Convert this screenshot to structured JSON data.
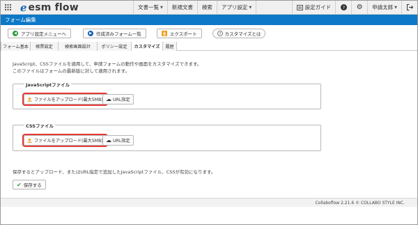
{
  "header": {
    "logo_text": "esm flow",
    "nav": [
      "文書一覧",
      "新規文書",
      "検索",
      "アプリ設定"
    ],
    "guide_label": "設定ガイド",
    "user_label": "申請太郎"
  },
  "title_bar": "フォーム編集",
  "toolbar": {
    "back_label": "アプリ設定メニューへ",
    "forms_label": "作成済みフォーム一覧",
    "export_label": "エクスポート",
    "customize_help_label": "カスタマイズとは"
  },
  "tabs": [
    "フォーム基本",
    "帳票設定",
    "検索画面設計",
    "ポリシー設定",
    "カスタマイズ",
    "履歴"
  ],
  "active_tab": "カスタマイズ",
  "description": {
    "line1": "JavaScript、CSSファイルを適用して、申請フォームの動作や画面をカスタマイズできます。",
    "line2": "このファイルはフォームの最新版に対して適用されます。"
  },
  "sections": {
    "js": {
      "title": "JavaScriptファイル",
      "upload_label": "ファイルをアップロード(最大5MB)",
      "url_label": "URL指定"
    },
    "css": {
      "title": "CSSファイル",
      "upload_label": "ファイルをアップロード(最大5MB)",
      "url_label": "URL指定"
    }
  },
  "note": "保存するとアップロード、またはURL指定で追加したJavaScriptファイル、CSSが有効になります。",
  "save_label": "保存する",
  "footer": "Collaboflow 2.21.6 © COLLABO STYLE INC.",
  "colors": {
    "brand": "#1a62b4",
    "title_bar": "#0c78c7",
    "highlight": "#e53935",
    "upload_icon": "#f0a020"
  }
}
